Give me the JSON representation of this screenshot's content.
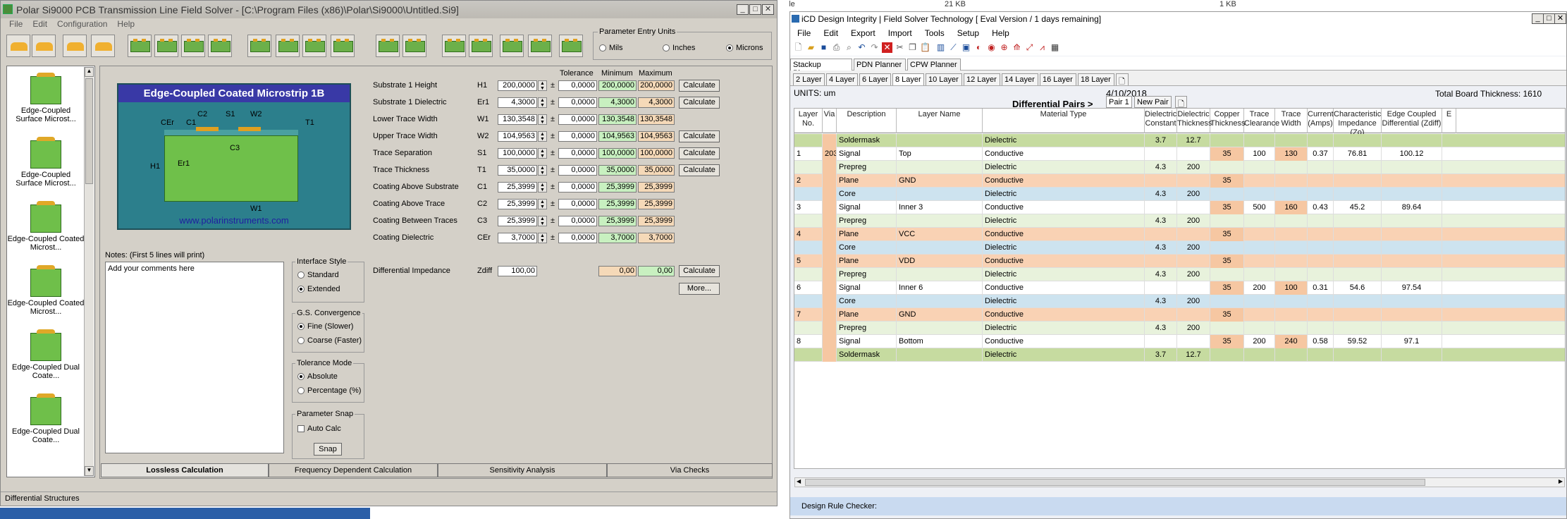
{
  "background": {
    "file_label": "File",
    "file_size": "21 KB",
    "file_size2": "1 KB"
  },
  "left": {
    "title": "Polar Si9000 PCB Transmission Line Field Solver - [C:\\Program Files (x86)\\Polar\\Si9000\\Untitled.Si9]",
    "menu": [
      "File",
      "Edit",
      "Configuration",
      "Help"
    ],
    "param_units": {
      "label": "Parameter Entry Units",
      "options": [
        "Mils",
        "Inches",
        "Microns"
      ],
      "selected": 2
    },
    "sidebar": [
      {
        "label": "Edge-Coupled Surface Microst..."
      },
      {
        "label": "Edge-Coupled Surface Microst..."
      },
      {
        "label": "Edge-Coupled Coated Microst..."
      },
      {
        "label": "Edge-Coupled Coated Microst..."
      },
      {
        "label": "Edge-Coupled Dual Coate..."
      },
      {
        "label": "Edge-Coupled Dual Coate..."
      }
    ],
    "diagram": {
      "title": "Edge-Coupled Coated Microstrip 1B",
      "url": "www.polarinstruments.com",
      "labels": {
        "c2": "C2",
        "s1": "S1",
        "w2": "W2",
        "cer": "CEr",
        "c1": "C1",
        "t1": "T1",
        "c3": "C3",
        "h1": "H1",
        "er1": "Er1",
        "w1": "W1"
      }
    },
    "col_headers": {
      "tol": "Tolerance",
      "min": "Minimum",
      "max": "Maximum"
    },
    "params": [
      {
        "label": "Substrate 1 Height",
        "sym": "H1",
        "val": "200,0000",
        "tol": "0,0000",
        "min": "200,0000",
        "max": "200,0000",
        "calc": "Calculate"
      },
      {
        "label": "Substrate 1 Dielectric",
        "sym": "Er1",
        "val": "4,3000",
        "tol": "0,0000",
        "min": "4,3000",
        "max": "4,3000",
        "calc": "Calculate"
      },
      {
        "label": "Lower Trace Width",
        "sym": "W1",
        "val": "130,3548",
        "tol": "0,0000",
        "min": "130,3548",
        "max": "130,3548",
        "calc": ""
      },
      {
        "label": "Upper Trace Width",
        "sym": "W2",
        "val": "104,9563",
        "tol": "0,0000",
        "min": "104,9563",
        "max": "104,9563",
        "calc": "Calculate"
      },
      {
        "label": "Trace Separation",
        "sym": "S1",
        "val": "100,0000",
        "tol": "0,0000",
        "min": "100,0000",
        "max": "100,0000",
        "calc": "Calculate"
      },
      {
        "label": "Trace Thickness",
        "sym": "T1",
        "val": "35,0000",
        "tol": "0,0000",
        "min": "35,0000",
        "max": "35,0000",
        "calc": "Calculate"
      },
      {
        "label": "Coating Above Substrate",
        "sym": "C1",
        "val": "25,3999",
        "tol": "0,0000",
        "min": "25,3999",
        "max": "25,3999",
        "calc": ""
      },
      {
        "label": "Coating Above Trace",
        "sym": "C2",
        "val": "25,3999",
        "tol": "0,0000",
        "min": "25,3999",
        "max": "25,3999",
        "calc": ""
      },
      {
        "label": "Coating Between Traces",
        "sym": "C3",
        "val": "25,3999",
        "tol": "0,0000",
        "min": "25,3999",
        "max": "25,3999",
        "calc": ""
      },
      {
        "label": "Coating Dielectric",
        "sym": "CEr",
        "val": "3,7000",
        "tol": "0,0000",
        "min": "3,7000",
        "max": "3,7000",
        "calc": ""
      }
    ],
    "zdiff": {
      "label": "Differential Impedance",
      "sym": "Zdiff",
      "val": "100,00",
      "min": "0,00",
      "max": "0,00",
      "calc": "Calculate",
      "more": "More..."
    },
    "notes_label": "Notes: (First 5 lines will print)",
    "notes_text": "Add your comments here",
    "interface": {
      "label": "Interface Style",
      "options": [
        "Standard",
        "Extended"
      ],
      "selected": 1
    },
    "gs": {
      "label": "G.S. Convergence",
      "options": [
        "Fine (Slower)",
        "Coarse (Faster)"
      ],
      "selected": 0
    },
    "tolmode": {
      "label": "Tolerance Mode",
      "options": [
        "Absolute",
        "Percentage (%)"
      ],
      "selected": 0
    },
    "snap": {
      "label": "Parameter Snap",
      "auto": "Auto Calc",
      "button": "Snap"
    },
    "tabs": [
      "Lossless Calculation",
      "Frequency Dependent Calculation",
      "Sensitivity Analysis",
      "Via Checks"
    ],
    "status": "Differential Structures"
  },
  "right": {
    "title": "iCD Design Integrity  | Field Solver Technology [ Eval Version / 1 days remaining]",
    "menu": [
      "File",
      "Edit",
      "Export",
      "Import",
      "Tools",
      "Setup",
      "Help"
    ],
    "planners": [
      "Stackup Planner",
      "PDN Planner",
      "CPW Planner"
    ],
    "layer_tabs": [
      "2 Layer",
      "4 Layer",
      "6 Layer",
      "8 Layer",
      "10 Layer",
      "12 Layer",
      "14 Layer",
      "16 Layer",
      "18 Layer"
    ],
    "units": "UNITS: um",
    "date": "4/10/2018",
    "total": "Total Board Thickness: 1610",
    "dp_label": "Differential Pairs >",
    "pair_tabs": [
      "Pair 1",
      "New Pair"
    ],
    "headers": [
      "Layer No.",
      "Via",
      "Description",
      "Layer Name",
      "Material Type",
      "Dielectric Constant",
      "Dielectric Thickness",
      "Copper Thickness",
      "Trace Clearance",
      "Trace Width",
      "Current (Amps)",
      "Characteristic Impedance (Zo)",
      "Edge Coupled Differential (Zdiff)",
      "E"
    ],
    "rows": [
      {
        "type": "sm",
        "no": "",
        "via": "",
        "desc": "Soldermask",
        "name": "",
        "mat": "Dielectric",
        "dk": "3.7",
        "dt": "12.7",
        "cu": "",
        "tc": "",
        "tw": "",
        "cur": "",
        "zo": "",
        "zd": ""
      },
      {
        "type": "sig",
        "no": "1",
        "via": "203",
        "desc": "Signal",
        "name": "Top",
        "mat": "Conductive",
        "dk": "",
        "dt": "",
        "cu": "35",
        "tc": "100",
        "tw": "130",
        "cur": "0.37",
        "zo": "76.81",
        "zd": "100.12"
      },
      {
        "type": "pp",
        "no": "",
        "via": "",
        "desc": "Prepreg",
        "name": "",
        "mat": "Dielectric",
        "dk": "4.3",
        "dt": "200",
        "cu": "",
        "tc": "",
        "tw": "",
        "cur": "",
        "zo": "",
        "zd": ""
      },
      {
        "type": "pl",
        "no": "2",
        "via": "",
        "desc": "Plane",
        "name": "GND",
        "mat": "Conductive",
        "dk": "",
        "dt": "",
        "cu": "35",
        "tc": "",
        "tw": "",
        "cur": "",
        "zo": "",
        "zd": ""
      },
      {
        "type": "core",
        "no": "",
        "via": "",
        "desc": "Core",
        "name": "",
        "mat": "Dielectric",
        "dk": "4.3",
        "dt": "200",
        "cu": "",
        "tc": "",
        "tw": "",
        "cur": "",
        "zo": "",
        "zd": ""
      },
      {
        "type": "sig",
        "no": "3",
        "via": "",
        "desc": "Signal",
        "name": "Inner 3",
        "mat": "Conductive",
        "dk": "",
        "dt": "",
        "cu": "35",
        "tc": "500",
        "tw": "160",
        "cur": "0.43",
        "zo": "45.2",
        "zd": "89.64"
      },
      {
        "type": "pp",
        "no": "",
        "via": "",
        "desc": "Prepreg",
        "name": "",
        "mat": "Dielectric",
        "dk": "4.3",
        "dt": "200",
        "cu": "",
        "tc": "",
        "tw": "",
        "cur": "",
        "zo": "",
        "zd": ""
      },
      {
        "type": "pl",
        "no": "4",
        "via": "",
        "desc": "Plane",
        "name": "VCC",
        "mat": "Conductive",
        "dk": "",
        "dt": "",
        "cu": "35",
        "tc": "",
        "tw": "",
        "cur": "",
        "zo": "",
        "zd": ""
      },
      {
        "type": "core",
        "no": "",
        "via": "",
        "desc": "Core",
        "name": "",
        "mat": "Dielectric",
        "dk": "4.3",
        "dt": "200",
        "cu": "",
        "tc": "",
        "tw": "",
        "cur": "",
        "zo": "",
        "zd": ""
      },
      {
        "type": "pl",
        "no": "5",
        "via": "",
        "desc": "Plane",
        "name": "VDD",
        "mat": "Conductive",
        "dk": "",
        "dt": "",
        "cu": "35",
        "tc": "",
        "tw": "",
        "cur": "",
        "zo": "",
        "zd": ""
      },
      {
        "type": "pp",
        "no": "",
        "via": "",
        "desc": "Prepreg",
        "name": "",
        "mat": "Dielectric",
        "dk": "4.3",
        "dt": "200",
        "cu": "",
        "tc": "",
        "tw": "",
        "cur": "",
        "zo": "",
        "zd": ""
      },
      {
        "type": "sig",
        "no": "6",
        "via": "",
        "desc": "Signal",
        "name": "Inner 6",
        "mat": "Conductive",
        "dk": "",
        "dt": "",
        "cu": "35",
        "tc": "200",
        "tw": "100",
        "cur": "0.31",
        "zo": "54.6",
        "zd": "97.54"
      },
      {
        "type": "core",
        "no": "",
        "via": "",
        "desc": "Core",
        "name": "",
        "mat": "Dielectric",
        "dk": "4.3",
        "dt": "200",
        "cu": "",
        "tc": "",
        "tw": "",
        "cur": "",
        "zo": "",
        "zd": ""
      },
      {
        "type": "pl",
        "no": "7",
        "via": "",
        "desc": "Plane",
        "name": "GND",
        "mat": "Conductive",
        "dk": "",
        "dt": "",
        "cu": "35",
        "tc": "",
        "tw": "",
        "cur": "",
        "zo": "",
        "zd": ""
      },
      {
        "type": "pp",
        "no": "",
        "via": "",
        "desc": "Prepreg",
        "name": "",
        "mat": "Dielectric",
        "dk": "4.3",
        "dt": "200",
        "cu": "",
        "tc": "",
        "tw": "",
        "cur": "",
        "zo": "",
        "zd": ""
      },
      {
        "type": "sig",
        "no": "8",
        "via": "",
        "desc": "Signal",
        "name": "Bottom",
        "mat": "Conductive",
        "dk": "",
        "dt": "",
        "cu": "35",
        "tc": "200",
        "tw": "240",
        "cur": "0.58",
        "zo": "59.52",
        "zd": "97.1"
      },
      {
        "type": "sm",
        "no": "",
        "via": "",
        "desc": "Soldermask",
        "name": "",
        "mat": "Dielectric",
        "dk": "3.7",
        "dt": "12.7",
        "cu": "",
        "tc": "",
        "tw": "",
        "cur": "",
        "zo": "",
        "zd": ""
      }
    ],
    "drc": "Design Rule Checker:",
    "colors": {
      "soldermask": "#c6dba0",
      "signal": "#ffffff",
      "prepreg": "#e8f2dc",
      "plane": "#f9d2b4",
      "core": "#cde3ef",
      "accent": "#f6c7a2"
    }
  }
}
